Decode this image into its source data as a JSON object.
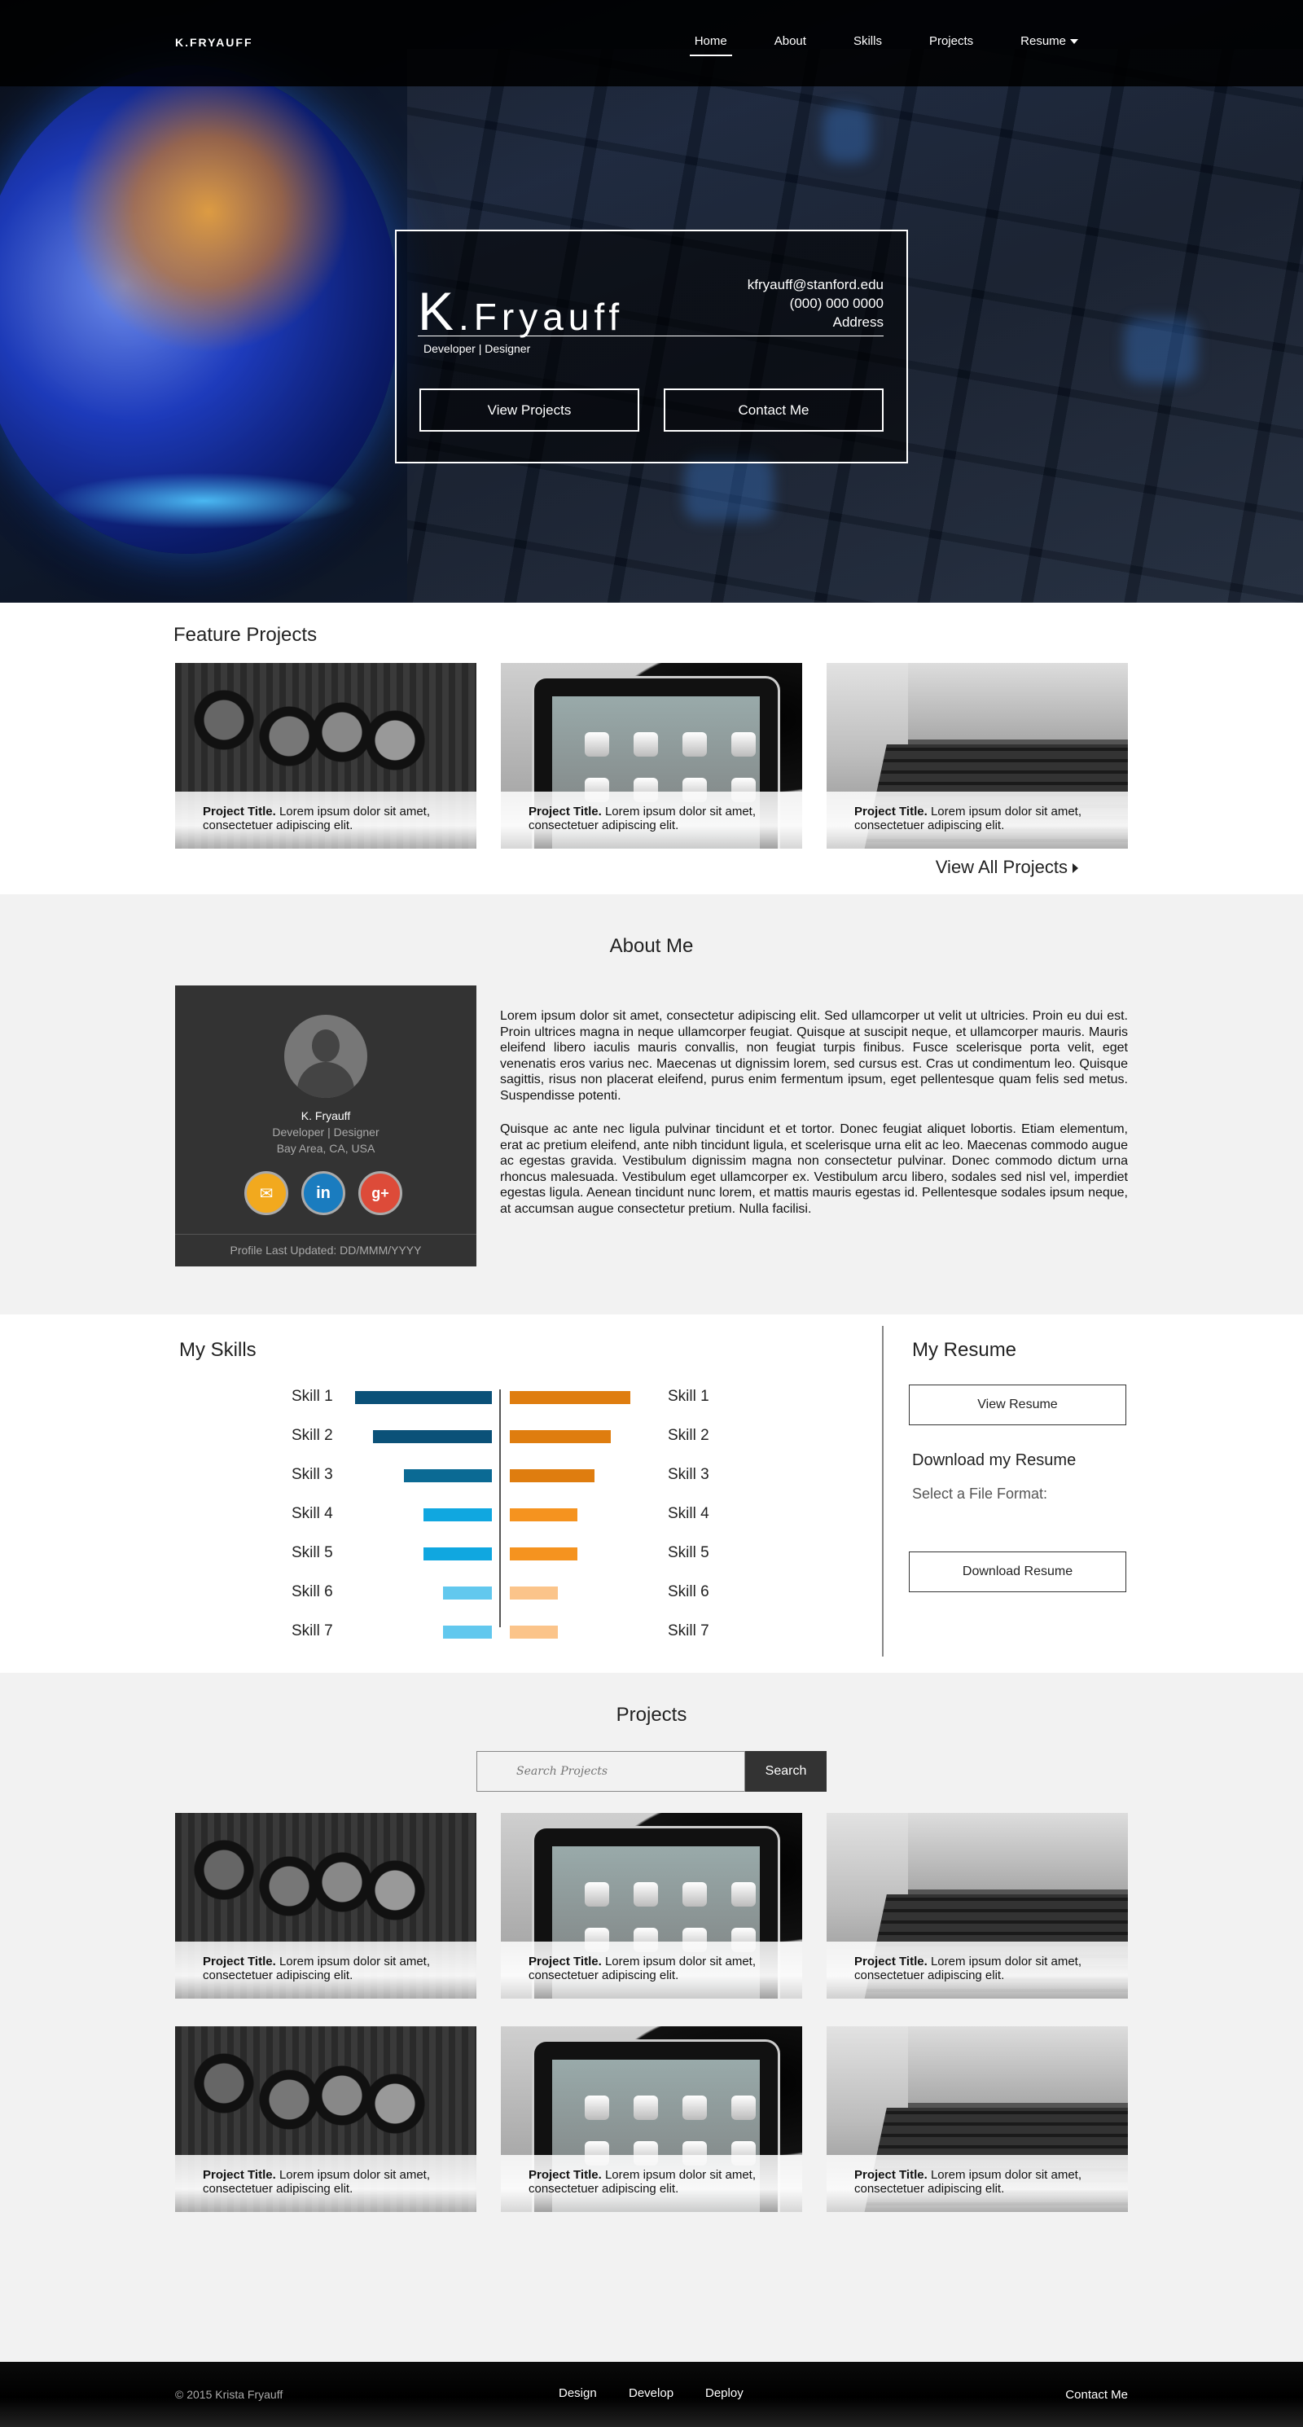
{
  "header": {
    "brand": "K.FRYAUFF",
    "nav": [
      {
        "label": "Home",
        "active": true
      },
      {
        "label": "About",
        "active": false
      },
      {
        "label": "Skills",
        "active": false
      },
      {
        "label": "Projects",
        "active": false
      },
      {
        "label": "Resume",
        "active": false,
        "dropdown": true
      }
    ]
  },
  "hero": {
    "initial": "K",
    "surname": ".Fryauff",
    "role": "Developer | Designer",
    "email": "kfryauff@stanford.edu",
    "phone": "(000) 000 0000",
    "address": "Address",
    "buttons": [
      "View Projects",
      "Contact Me"
    ]
  },
  "feature": {
    "title": "Feature Projects",
    "card_title": "Project Title.",
    "card_text": "Lorem ipsum dolor sit amet, consectetuer adipiscing elit.",
    "view_all": "View All Projects"
  },
  "about": {
    "title": "About Me",
    "name": "K. Fryauff",
    "role": "Developer | Designer",
    "location": "Bay Area, CA, USA",
    "social": [
      "email-icon",
      "linkedin-icon",
      "google-plus-icon"
    ],
    "social_colors": [
      "#f2a91e",
      "#1a7cbf",
      "#dd4b39"
    ],
    "updated": "Profile Last Updated: DD/MMM/YYYY",
    "paragraphs": [
      "Lorem ipsum dolor sit amet, consectetur adipiscing elit. Sed ullamcorper ut velit ut ultricies. Proin eu dui est. Proin ultrices magna in neque ullamcorper feugiat. Quisque at suscipit neque, et ullamcorper mauris. Mauris eleifend libero iaculis mauris convallis, non feugiat turpis finibus. Fusce scelerisque porta velit, eget venenatis eros varius nec. Maecenas ut dignissim lorem, sed cursus est. Cras ut condimentum leo. Quisque sagittis, risus non placerat eleifend, purus enim fermentum ipsum, eget pellentesque quam felis sed metus. Suspendisse potenti.",
      "Quisque ac ante nec ligula pulvinar tincidunt et et tortor. Donec feugiat aliquet lobortis. Etiam elementum, erat ac pretium eleifend, ante nibh tincidunt ligula, et scelerisque urna elit ac leo. Maecenas commodo augue ac egestas gravida. Vestibulum dignissim magna non consectetur pulvinar. Donec commodo dictum urna rhoncus malesuada. Vestibulum eget ullamcorper ex. Vestibulum arcu libero, sodales sed nisl vel, imperdiet egestas ligula. Aenean tincidunt nunc lorem, et mattis mauris egestas id. Pellentesque sodales ipsum neque, at accumsan augue consectetur pretium. Nulla facilisi."
    ]
  },
  "skills": {
    "title": "My Skills",
    "left": [
      {
        "label": "Skill 1",
        "level": 1.0,
        "color": "#0b5178"
      },
      {
        "label": "Skill 2",
        "level": 0.87,
        "color": "#0b5178"
      },
      {
        "label": "Skill 3",
        "level": 0.64,
        "color": "#0b6a94"
      },
      {
        "label": "Skill 4",
        "level": 0.5,
        "color": "#10a7e0"
      },
      {
        "label": "Skill 5",
        "level": 0.5,
        "color": "#10a7e0"
      },
      {
        "label": "Skill 6",
        "level": 0.36,
        "color": "#62c8ee"
      },
      {
        "label": "Skill 7",
        "level": 0.36,
        "color": "#62c8ee"
      }
    ],
    "right": [
      {
        "label": "Skill 1",
        "level": 1.0,
        "color": "#df7d0f"
      },
      {
        "label": "Skill 2",
        "level": 0.84,
        "color": "#df7d0f"
      },
      {
        "label": "Skill 3",
        "level": 0.7,
        "color": "#df7d0f"
      },
      {
        "label": "Skill 4",
        "level": 0.56,
        "color": "#f5931f"
      },
      {
        "label": "Skill 5",
        "level": 0.56,
        "color": "#f5931f"
      },
      {
        "label": "Skill 6",
        "level": 0.4,
        "color": "#fbc48a"
      },
      {
        "label": "Skill 7",
        "level": 0.4,
        "color": "#fbc48a"
      }
    ]
  },
  "resume": {
    "title": "My Resume",
    "view_btn": "View Resume",
    "download_title": "Download my Resume",
    "format_label": "Select a File Format:",
    "download_btn": "Download Resume"
  },
  "projects": {
    "title": "Projects",
    "search_placeholder": "Search Projects",
    "search_btn": "Search",
    "card_title": "Project Title.",
    "card_text": "Lorem ipsum dolor sit amet, consectetuer adipiscing elit."
  },
  "footer": {
    "copyright": "© 2015 Krista Fryauff",
    "links": [
      "Design",
      "Develop",
      "Deploy"
    ],
    "contact": "Contact Me"
  }
}
